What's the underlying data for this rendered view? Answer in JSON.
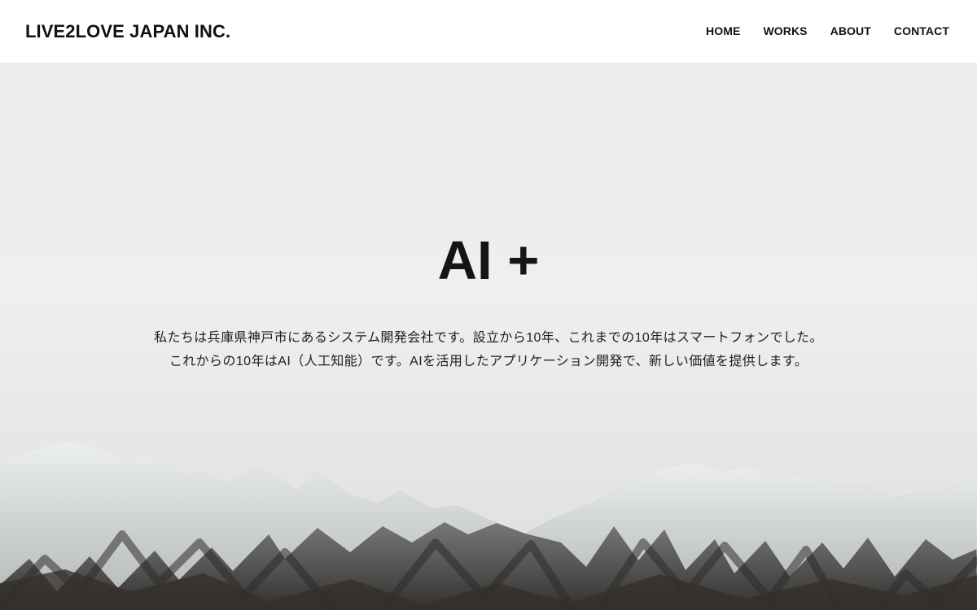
{
  "brand": {
    "name": "LIVE2LOVE JAPAN INC."
  },
  "nav": {
    "items": [
      {
        "label": "HOME"
      },
      {
        "label": "WORKS"
      },
      {
        "label": "ABOUT"
      },
      {
        "label": "CONTACT"
      }
    ]
  },
  "hero": {
    "title": "AI +",
    "lines": [
      "私たちは兵庫県神戸市にあるシステム開発会社です。設立から10年、これまでの10年はスマートフォンでした。",
      "これからの10年はAI（人工知能）です。AIを活用したアプリケーション開発で、新しい価値を提供します。"
    ],
    "image": "snowy-mountain-range"
  },
  "colors": {
    "header_background": "#ffffff",
    "text": "#151515",
    "sky": "#ecedeb",
    "snow": "#dfe2e2",
    "rock": "#3d3b39"
  }
}
